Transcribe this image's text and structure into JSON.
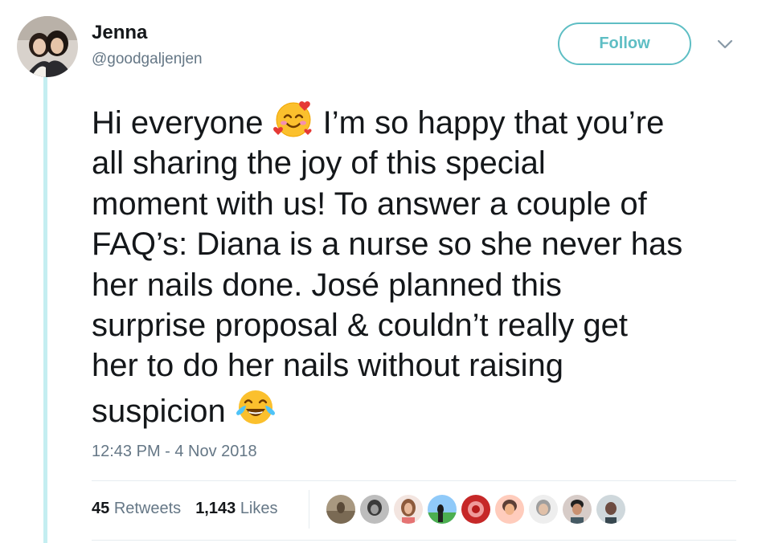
{
  "author": {
    "name": "Jenna",
    "handle": "@goodgaljenjen"
  },
  "follow_label": "Follow",
  "tweet": {
    "lines": [
      [
        "Hi everyone ",
        "emoji:smiling-face-with-hearts",
        " I’m so happy that you’re"
      ],
      [
        "all sharing the joy of this special"
      ],
      [
        "moment with us! To answer a couple of"
      ],
      [
        "FAQ’s: Diana is a nurse so she never has"
      ],
      [
        "her nails done. José planned this"
      ],
      [
        "surprise proposal & couldn’t really get"
      ],
      [
        "her to do her nails without raising"
      ],
      [
        "suspicion ",
        "emoji:face-with-tears-of-joy"
      ]
    ]
  },
  "timestamp": "12:43 PM - 4 Nov 2018",
  "stats": {
    "retweets_count": "45",
    "retweets_label": "Retweets",
    "likes_count": "1,143",
    "likes_label": "Likes"
  },
  "likers": [
    "liker-avatar-1",
    "liker-avatar-2",
    "liker-avatar-3",
    "liker-avatar-4",
    "liker-avatar-5",
    "liker-avatar-6",
    "liker-avatar-7",
    "liker-avatar-8",
    "liker-avatar-9"
  ],
  "colors": {
    "accent": "#5ebec4",
    "thread_line": "#c4eef1",
    "secondary_text": "#657786"
  }
}
